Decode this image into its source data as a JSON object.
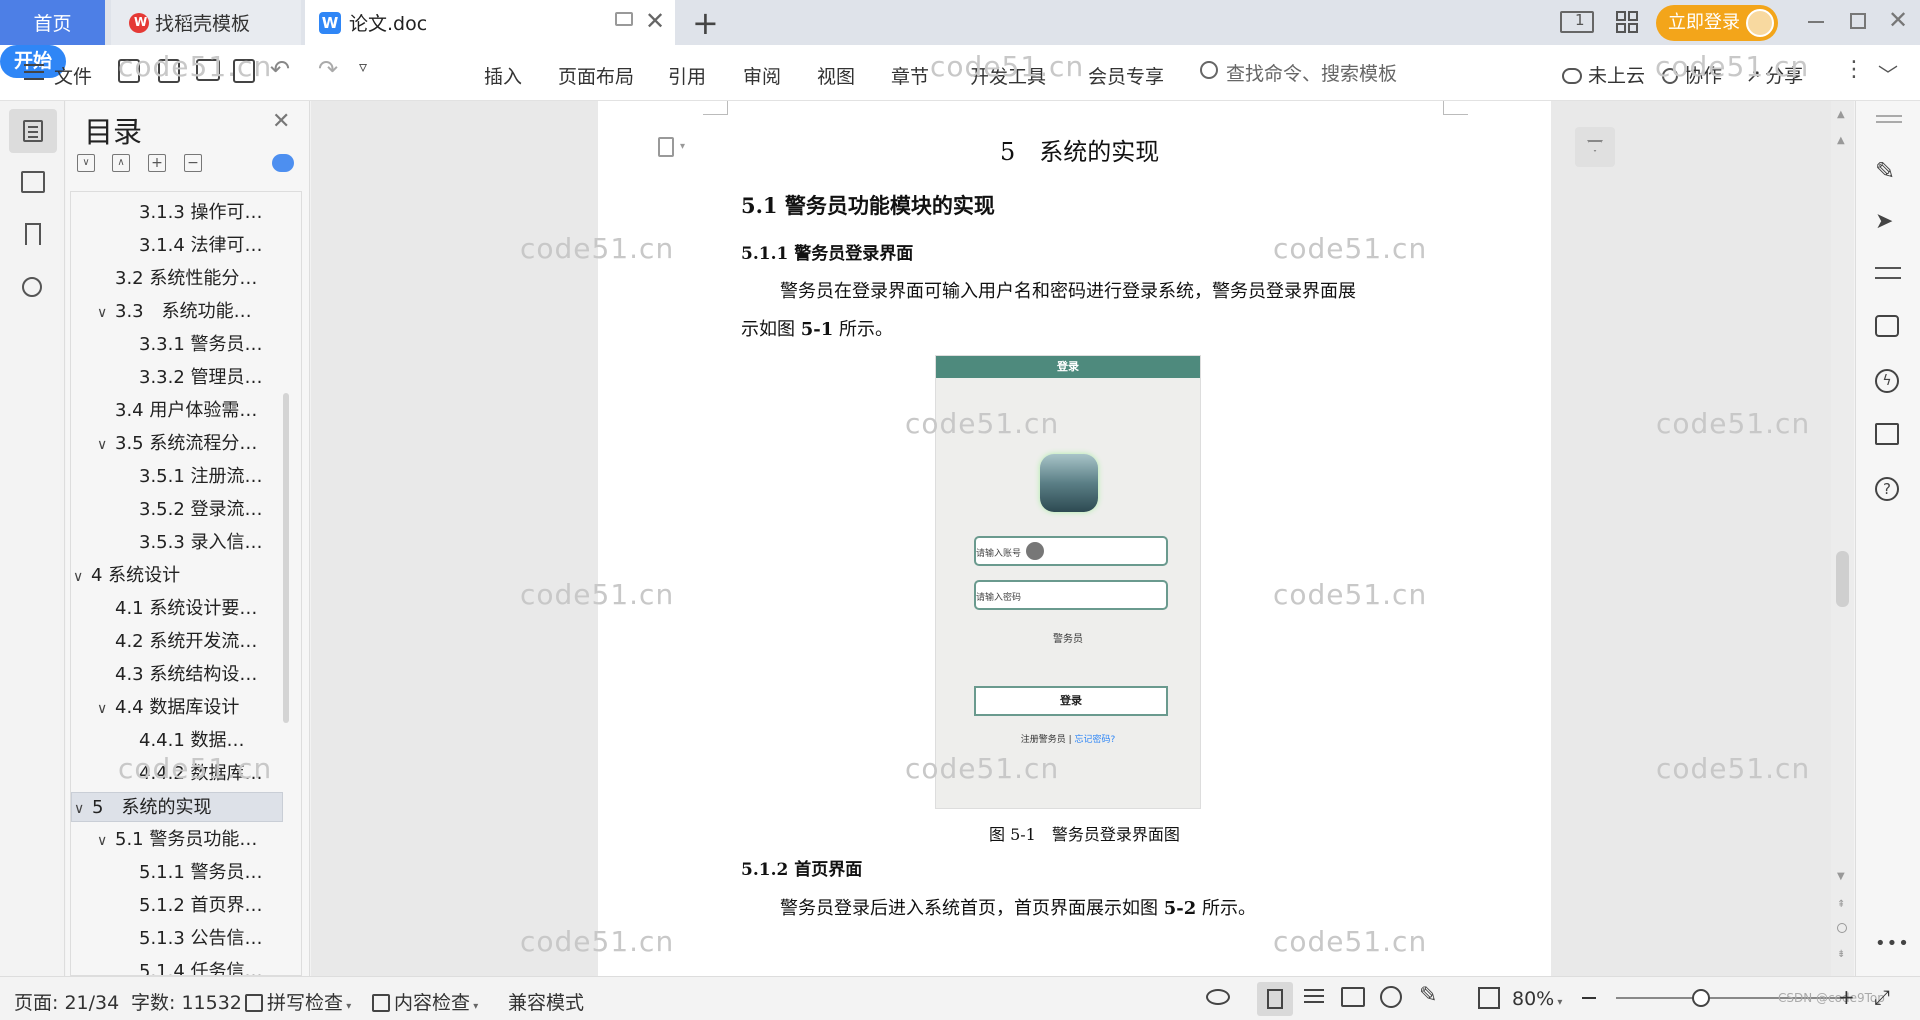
{
  "tabs": {
    "home": "首页",
    "template": "找稻壳模板",
    "doc": "论文.doc",
    "login_btn": "立即登录"
  },
  "toolbar": {
    "file": "文件",
    "menus": [
      "开始",
      "插入",
      "页面布局",
      "引用",
      "审阅",
      "视图",
      "章节",
      "开发工具",
      "会员专享"
    ],
    "search_placeholder": "查找命令、搜索模板",
    "cloud": "未上云",
    "collab": "协作",
    "share": "分享"
  },
  "toc": {
    "title": "目录",
    "items": [
      {
        "label": "3.1.3 操作可…",
        "level": 3
      },
      {
        "label": "3.1.4 法律可…",
        "level": 3
      },
      {
        "label": "3.2 系统性能分…",
        "level": 2
      },
      {
        "label": "3.3　系统功能…",
        "level": 2,
        "chev": "∨"
      },
      {
        "label": "3.3.1 警务员…",
        "level": 3
      },
      {
        "label": "3.3.2 管理员…",
        "level": 3
      },
      {
        "label": "3.4 用户体验需…",
        "level": 2
      },
      {
        "label": "3.5 系统流程分…",
        "level": 2,
        "chev": "∨"
      },
      {
        "label": "3.5.1 注册流…",
        "level": 3
      },
      {
        "label": "3.5.2 登录流…",
        "level": 3
      },
      {
        "label": "3.5.3 录入信…",
        "level": 3
      },
      {
        "label": "4 系统设计",
        "level": 1,
        "chev": "∨"
      },
      {
        "label": "4.1 系统设计要…",
        "level": 2
      },
      {
        "label": "4.2 系统开发流…",
        "level": 2
      },
      {
        "label": "4.3 系统结构设…",
        "level": 2
      },
      {
        "label": "4.4 数据库设计",
        "level": 2,
        "chev": "∨"
      },
      {
        "label": "4.4.1 数据…",
        "level": 3
      },
      {
        "label": "4.4.2 数据库…",
        "level": 3
      },
      {
        "label": "5　系统的实现",
        "level": 1,
        "chev": "∨",
        "selected": true
      },
      {
        "label": "5.1 警务员功能…",
        "level": 2,
        "chev": "∨"
      },
      {
        "label": "5.1.1 警务员…",
        "level": 3
      },
      {
        "label": "5.1.2 首页界…",
        "level": 3
      },
      {
        "label": "5.1.3 公告信…",
        "level": 3
      },
      {
        "label": "5.1.4 任务信…",
        "level": 3
      }
    ]
  },
  "document": {
    "chapter_title": "5　系统的实现",
    "section_title": "5.1 警务员功能模块的实现",
    "sub1_title": "5.1.1 警务员登录界面",
    "para1_line1": "警务员在登录界面可输入用户名和密码进行登录系统，警务员登录界面展",
    "para1_line2_a": "示如图 ",
    "para1_line2_b": "5-1",
    "para1_line2_c": " 所示。",
    "figure_caption": "图 5-1　警务员登录界面图",
    "sub2_title": "5.1.2 首页界面",
    "para2_a": "警务员登录后进入系统首页，首页界面展示如图 ",
    "para2_b": "5-2",
    "para2_c": " 所示。",
    "login_mock": {
      "header": "登录",
      "account_placeholder": "请输入账号",
      "password_placeholder": "请输入密码",
      "role": "警务员",
      "login_btn": "登录",
      "register_link": "注册警务员",
      "forgot_link": "忘记密码?"
    }
  },
  "watermark": "code51.cn",
  "status": {
    "page": "页面: 21/34",
    "words": "字数: 11532",
    "spell": "拼写检查",
    "content": "内容检查",
    "compat": "兼容模式",
    "zoom": "80%",
    "csdn": "CSDN @code9Top"
  },
  "colors": {
    "accent": "#2f86f6",
    "home_tab": "#4d7fe6",
    "login_orange": "#f3a51a",
    "mock_header": "#4e8a7d"
  }
}
